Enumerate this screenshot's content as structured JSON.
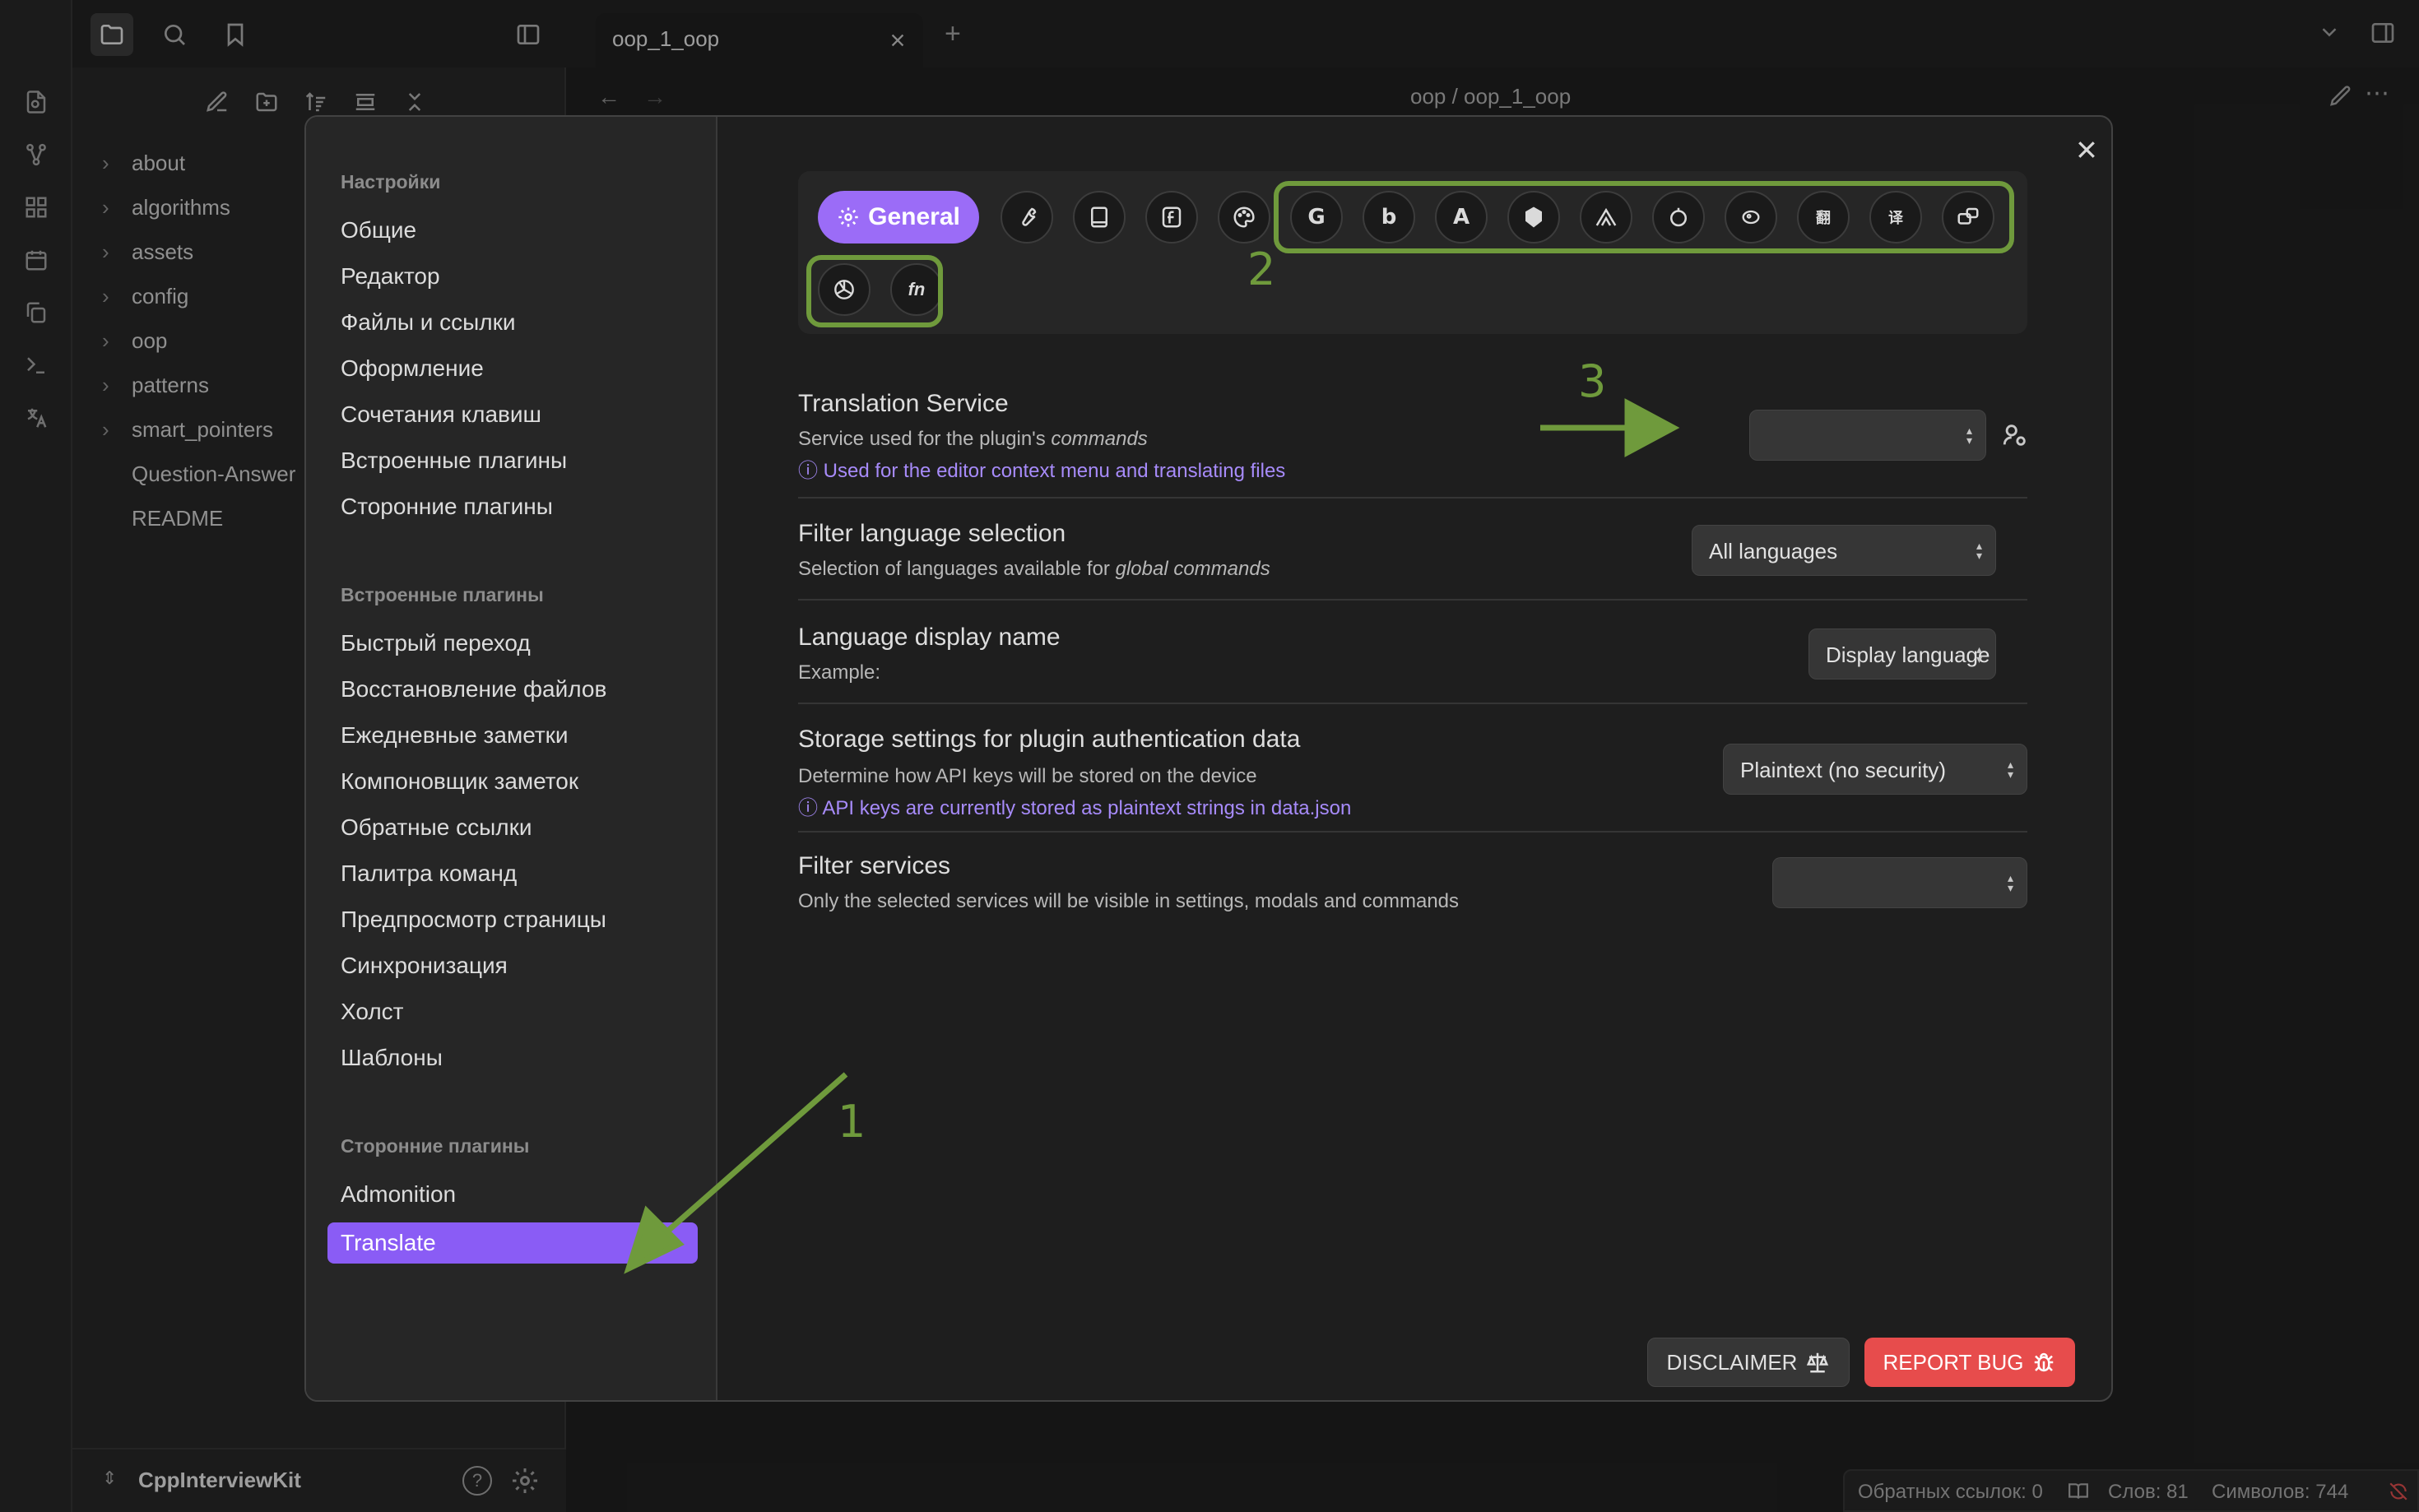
{
  "app": {
    "tab_title": "oop_1_oop",
    "breadcrumb": "oop / oop_1_oop",
    "vault_name": "CppInterviewKit"
  },
  "explorer": {
    "items": [
      {
        "label": "about",
        "folder": true
      },
      {
        "label": "algorithms",
        "folder": true
      },
      {
        "label": "assets",
        "folder": true
      },
      {
        "label": "config",
        "folder": true
      },
      {
        "label": "oop",
        "folder": true
      },
      {
        "label": "patterns",
        "folder": true
      },
      {
        "label": "smart_pointers",
        "folder": true
      },
      {
        "label": "Question-Answer",
        "folder": false
      },
      {
        "label": "README",
        "folder": false
      }
    ]
  },
  "status": {
    "backlinks": "Обратных ссылок: 0",
    "words": "Слов: 81",
    "chars": "Символов: 744"
  },
  "settings_nav": {
    "section1_title": "Настройки",
    "section1": [
      "Общие",
      "Редактор",
      "Файлы и ссылки",
      "Оформление",
      "Сочетания клавиш",
      "Встроенные плагины",
      "Сторонние плагины"
    ],
    "section2_title": "Встроенные плагины",
    "section2": [
      "Быстрый переход",
      "Восстановление файлов",
      "Ежедневные заметки",
      "Компоновщик заметок",
      "Обратные ссылки",
      "Палитра команд",
      "Предпросмотр страницы",
      "Синхронизация",
      "Холст",
      "Шаблоны"
    ],
    "section3_title": "Сторонние плагины",
    "section3": [
      "Admonition",
      "Translate"
    ],
    "active": "Translate"
  },
  "plugin": {
    "general_tab": "General",
    "accent": "#9b6cf7",
    "annotation_color": "#6f9a3c",
    "annotations": [
      "1",
      "2",
      "3"
    ],
    "settings": {
      "translation_service": {
        "name": "Translation Service",
        "desc_prefix": "Service used for the plugin's ",
        "desc_em": "commands",
        "note": "ⓘ Used for the editor context menu and translating files",
        "value": ""
      },
      "filter_language": {
        "name": "Filter language selection",
        "desc_prefix": "Selection of languages available for ",
        "desc_em": "global commands",
        "value": "All languages"
      },
      "display_name": {
        "name": "Language display name",
        "desc": "Example:",
        "value": "Display language"
      },
      "storage": {
        "name": "Storage settings for plugin authentication data",
        "desc": "Determine how API keys will be stored on the device",
        "note": "ⓘ API keys are currently stored as plaintext strings in data.json",
        "value": "Plaintext (no security)"
      },
      "filter_services": {
        "name": "Filter services",
        "desc": "Only the selected services will be visible in settings, modals and commands",
        "value": ""
      }
    },
    "buttons": {
      "disclaimer": "DISCLAIMER",
      "report_bug": "REPORT BUG"
    }
  }
}
